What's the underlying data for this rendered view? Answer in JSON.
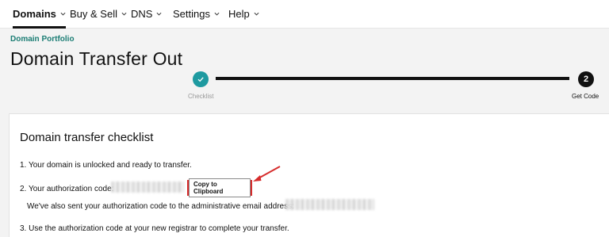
{
  "nav": {
    "items": [
      {
        "label": "Domains"
      },
      {
        "label": "Buy & Sell"
      },
      {
        "label": "DNS"
      },
      {
        "label": "Settings"
      },
      {
        "label": "Help"
      }
    ]
  },
  "breadcrumb": "Domain Portfolio",
  "page_title": "Domain Transfer Out",
  "stepper": {
    "step1_label": "Checklist",
    "step2_number": "2",
    "step2_label": "Get Code"
  },
  "checklist": {
    "title": "Domain transfer checklist",
    "item1": "1. Your domain is unlocked and ready to transfer.",
    "item2": "2. Your authorization code:",
    "copy_button": "Copy to Clipboard",
    "item2_sub": "We've also sent your authorization code to the administrative email address:",
    "item3": "3. Use the authorization code at your new registrar to complete your transfer."
  },
  "colors": {
    "accent_teal": "#1e9aa0",
    "breadcrumb_green": "#1b7d74",
    "highlight_red": "#d62c2c"
  }
}
